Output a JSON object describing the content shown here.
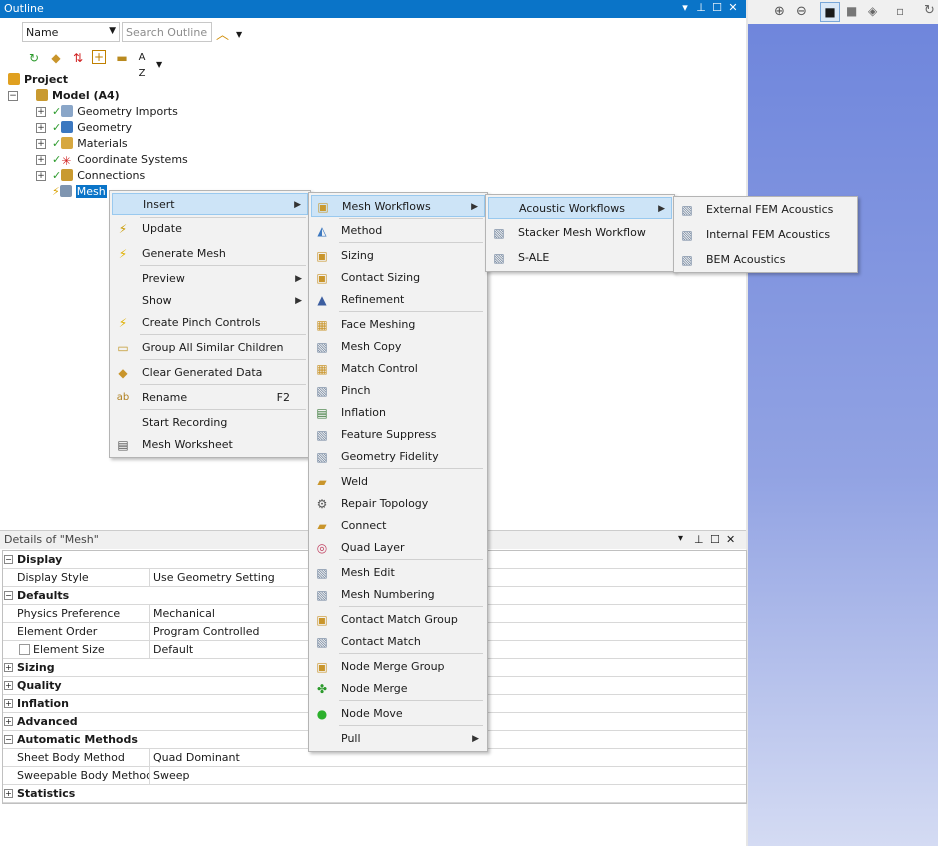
{
  "outline": {
    "title": "Outline",
    "name_field": "Name",
    "search_placeholder": "Search Outline",
    "sort_label": "A Z"
  },
  "tree": {
    "project": "Project",
    "model": "Model (A4)",
    "items": [
      "Geometry Imports",
      "Geometry",
      "Materials",
      "Coordinate Systems",
      "Connections"
    ],
    "mesh": "Mesh"
  },
  "context_menu": {
    "items": [
      {
        "label": "Insert",
        "icon": "none",
        "submenu": true
      },
      {
        "label": "Update",
        "icon": "update-icon"
      },
      {
        "label": "Generate Mesh",
        "icon": "lightning-icon"
      },
      {
        "label": "Preview",
        "submenu": true
      },
      {
        "label": "Show",
        "submenu": true
      },
      {
        "label": "Create Pinch Controls",
        "icon": "lightning-icon"
      },
      {
        "label": "Group All Similar Children",
        "icon": "folder-icon"
      },
      {
        "label": "Clear Generated Data",
        "icon": "eraser-icon"
      },
      {
        "label": "Rename",
        "icon": "rename-icon",
        "shortcut": "F2"
      },
      {
        "label": "Start Recording"
      },
      {
        "label": "Mesh Worksheet",
        "icon": "worksheet-icon"
      }
    ]
  },
  "insert_menu": {
    "items": [
      "Mesh Workflows",
      "Method",
      "Sizing",
      "Contact Sizing",
      "Refinement",
      "Face Meshing",
      "Mesh Copy",
      "Match Control",
      "Pinch",
      "Inflation",
      "Feature Suppress",
      "Geometry Fidelity",
      "Weld",
      "Repair Topology",
      "Connect",
      "Quad Layer",
      "Mesh Edit",
      "Mesh Numbering",
      "Contact Match Group",
      "Contact Match",
      "Node Merge Group",
      "Node Merge",
      "Node Move",
      "Pull"
    ]
  },
  "workflows_menu": {
    "items": [
      "Acoustic Workflows",
      "Stacker Mesh Workflow",
      "S-ALE"
    ]
  },
  "acoustic_menu": {
    "items": [
      "External FEM Acoustics",
      "Internal FEM Acoustics",
      "BEM Acoustics"
    ]
  },
  "details": {
    "title": "Details of \"Mesh\"",
    "display": "Display",
    "display_style_k": "Display Style",
    "display_style_v": "Use Geometry Setting",
    "defaults": "Defaults",
    "physics_k": "Physics Preference",
    "physics_v": "Mechanical",
    "order_k": "Element Order",
    "order_v": "Program Controlled",
    "size_k": "Element Size",
    "size_v": "Default",
    "sizing": "Sizing",
    "quality": "Quality",
    "inflation": "Inflation",
    "advanced": "Advanced",
    "auto": "Automatic Methods",
    "sheet_k": "Sheet Body Method",
    "sheet_v": "Quad Dominant",
    "sweep_k": "Sweepable Body Method",
    "sweep_v": "Sweep",
    "statistics": "Statistics"
  },
  "colors": {
    "title_bar": "#0a74c8",
    "menu_bg": "#f2f2f2",
    "highlight": "#cde4f7",
    "viewport": "#6f86dc"
  }
}
